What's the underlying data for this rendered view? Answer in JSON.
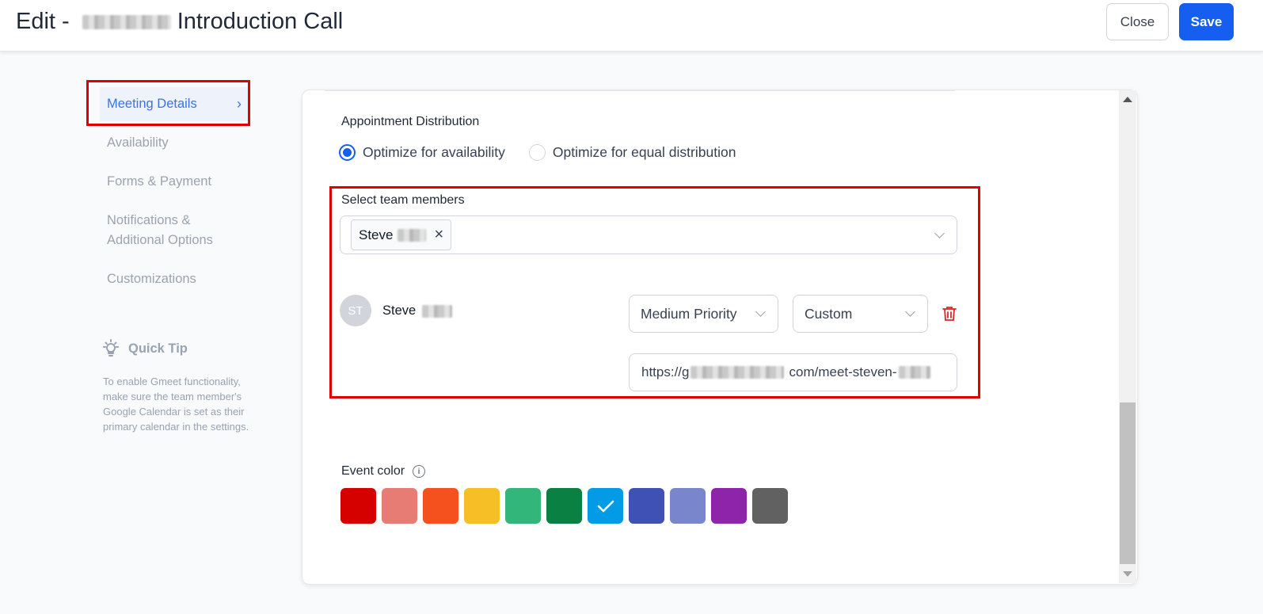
{
  "header": {
    "title_prefix": "Edit -",
    "title_suffix": "Introduction Call",
    "close_label": "Close",
    "save_label": "Save"
  },
  "sidebar": {
    "items": [
      {
        "label": "Meeting Details",
        "active": true
      },
      {
        "label": "Availability",
        "active": false
      },
      {
        "label": "Forms & Payment",
        "active": false
      },
      {
        "label": "Notifications & Additional Options",
        "active": false
      },
      {
        "label": "Customizations",
        "active": false
      }
    ]
  },
  "quick_tip": {
    "title": "Quick Tip",
    "text": "To enable Gmeet functionality, make sure the team member's Google Calendar is set as their primary calendar in the settings.",
    "icon": "lightbulb-icon"
  },
  "appointment": {
    "label": "Appointment Distribution",
    "options": [
      {
        "label": "Optimize for availability",
        "selected": true
      },
      {
        "label": "Optimize for equal distribution",
        "selected": false
      }
    ]
  },
  "team": {
    "label": "Select team members",
    "tags": [
      {
        "label": "Steve"
      }
    ],
    "members": [
      {
        "initials": "ST",
        "name": "Steve",
        "priority": "Medium Priority",
        "meeting_location": "Custom",
        "url_prefix": "https://g",
        "url_suffix": "com/meet-steven-"
      }
    ]
  },
  "event_color": {
    "label": "Event color",
    "colors": [
      "#d50000",
      "#e67c73",
      "#f4511e",
      "#f6bf26",
      "#33b679",
      "#0b8043",
      "#039be5",
      "#3f51b5",
      "#7986cb",
      "#8e24aa",
      "#616161"
    ],
    "selected_index": 6
  },
  "accent_color": "#155eef",
  "highlight_color": "#e00000"
}
